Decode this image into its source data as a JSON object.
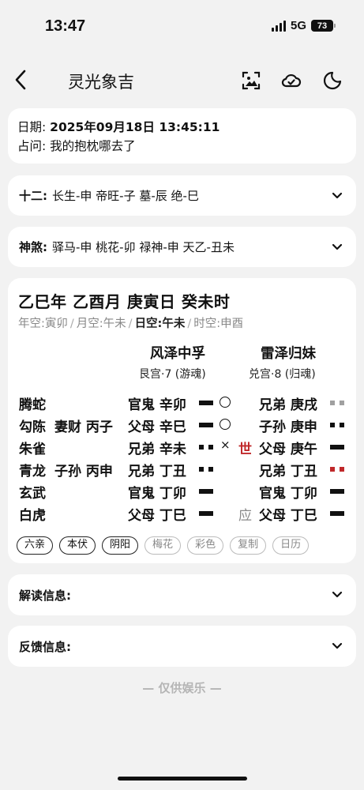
{
  "status": {
    "time": "13:47",
    "network": "5G",
    "battery": "73"
  },
  "nav": {
    "title": "灵光象吉"
  },
  "info": {
    "date_label": "日期:",
    "date_value": "2025年09月18日 13:45:11",
    "question_label": "占问:",
    "question_value": "我的抱枕哪去了"
  },
  "shier": {
    "label": "十二:",
    "value": "长生-申 帝旺-子 墓-辰 绝-巳"
  },
  "shensha": {
    "label": "神煞:",
    "value": "驿马-申 桃花-卯 禄神-申 天乙-丑未"
  },
  "pillars": "乙巳年 乙酉月 庚寅日 癸未时",
  "kong": {
    "year": "年空:寅卯",
    "month": "月空:午未",
    "day": "日空:午未",
    "hour": "时空:申酉",
    "sep": "/"
  },
  "gua": {
    "ben_name": "风泽中孚",
    "ben_palace": "艮宫·7 (游魂)",
    "bian_name": "雷泽归妹",
    "bian_palace": "兑宫·8 (归魂)"
  },
  "yao": [
    {
      "shen": "腾蛇",
      "fu": "",
      "ben": "官鬼 辛卯",
      "ben_line": "yang",
      "move": "○",
      "mark": "",
      "bian": "兄弟 庚戌",
      "bian_line": "yin-gray"
    },
    {
      "shen": "勾陈",
      "fu": "妻财 丙子",
      "ben": "父母 辛巳",
      "ben_line": "yang",
      "move": "○",
      "mark": "",
      "bian": "子孙 庚申",
      "bian_line": "yin"
    },
    {
      "shen": "朱雀",
      "fu": "",
      "ben": "兄弟 辛未",
      "ben_line": "yin",
      "move": "×",
      "mark": "世",
      "bian": "父母 庚午",
      "bian_line": "yang"
    },
    {
      "shen": "青龙",
      "fu": "子孙 丙申",
      "ben": "兄弟 丁丑",
      "ben_line": "yin",
      "move": "",
      "mark": "",
      "bian": "兄弟 丁丑",
      "bian_line": "yin-red"
    },
    {
      "shen": "玄武",
      "fu": "",
      "ben": "官鬼 丁卯",
      "ben_line": "yang",
      "move": "",
      "mark": "",
      "bian": "官鬼 丁卯",
      "bian_line": "yang"
    },
    {
      "shen": "白虎",
      "fu": "",
      "ben": "父母 丁巳",
      "ben_line": "yang",
      "move": "",
      "mark": "应",
      "bian": "父母 丁巳",
      "bian_line": "yang"
    }
  ],
  "chips": [
    {
      "label": "六亲",
      "active": true
    },
    {
      "label": "本伏",
      "active": true
    },
    {
      "label": "阴阳",
      "active": true
    },
    {
      "label": "梅花",
      "active": false
    },
    {
      "label": "彩色",
      "active": false
    },
    {
      "label": "复制",
      "active": false
    },
    {
      "label": "日历",
      "active": false
    }
  ],
  "jiedu": {
    "label": "解读信息:"
  },
  "fankui": {
    "label": "反馈信息:"
  },
  "footer": "— 仅供娱乐 —"
}
